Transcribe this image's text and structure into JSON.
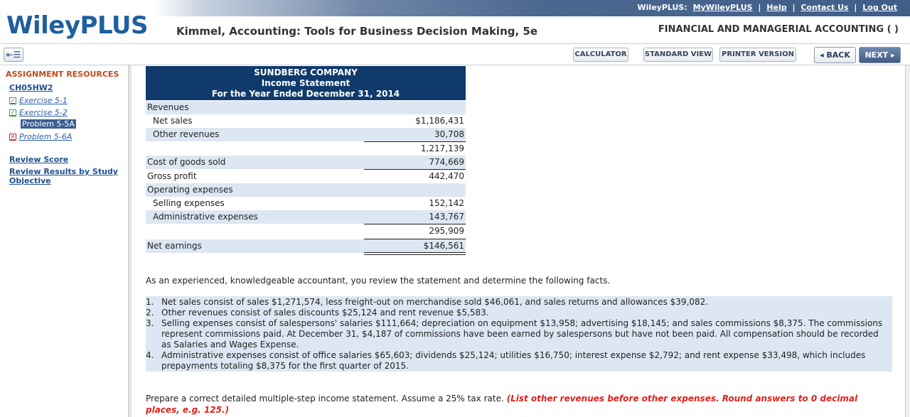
{
  "header": {
    "logo": "WileyPLUS",
    "top_links": {
      "prefix": "WileyPLUS:",
      "my": "MyWileyPLUS",
      "help": "Help",
      "contact": "Contact Us",
      "logout": "Log Out",
      "sep": "|"
    },
    "course_title": "Kimmel, Accounting: Tools for Business Decision Making, 5e",
    "course_name": "FINANCIAL AND MANAGERIAL ACCOUNTING ( )"
  },
  "toolbar": {
    "toggle_icon": "panel-toggle-icon",
    "calculator": "CALCULATOR",
    "standard_view": "STANDARD VIEW",
    "printer_version": "PRINTER VERSION",
    "back": "◂ BACK",
    "next": "NEXT ▸"
  },
  "sidebar": {
    "title": "ASSIGNMENT RESOURCES",
    "assignment": "CH05HW2",
    "items": [
      {
        "label": "Exercise 5-1",
        "status": "complete"
      },
      {
        "label": "Exercise 5-2",
        "status": "complete"
      },
      {
        "label": "Problem 5-5A",
        "status": "current"
      },
      {
        "label": "Problem 5-6A",
        "status": "incorrect"
      }
    ],
    "review_score": "Review Score",
    "review_results": "Review Results by Study Objective"
  },
  "statement": {
    "company": "SUNDBERG COMPANY",
    "title": "Income Statement",
    "period": "For the Year Ended December 31, 2014",
    "rows": [
      {
        "label": "Revenues",
        "amount": ""
      },
      {
        "label": "Net sales",
        "amount": "$1,186,431"
      },
      {
        "label": "Other revenues",
        "amount": "30,708"
      },
      {
        "label": "",
        "amount": "1,217,139"
      },
      {
        "label": "Cost of goods sold",
        "amount": "774,669"
      },
      {
        "label": "Gross profit",
        "amount": "442,470"
      },
      {
        "label": "Operating expenses",
        "amount": ""
      },
      {
        "label": "Selling expenses",
        "amount": "152,142"
      },
      {
        "label": "Administrative expenses",
        "amount": "143,767"
      },
      {
        "label": "",
        "amount": "295,909"
      },
      {
        "label": "Net earnings",
        "amount": "$146,561"
      }
    ]
  },
  "intro": "As an experienced, knowledgeable accountant, you review the statement and determine the following facts.",
  "facts": [
    {
      "num": "1.",
      "text": "Net sales consist of sales $1,271,574, less freight-out on merchandise sold $46,061, and sales returns and allowances $39,082."
    },
    {
      "num": "2.",
      "text": "Other revenues consist of sales discounts $25,124 and rent revenue $5,583."
    },
    {
      "num": "3.",
      "text": "Selling expenses consist of salespersons' salaries $111,664; depreciation on equipment $13,958; advertising $18,145; and sales commissions $8,375. The commissions represent commissions paid. At December 31, $4,187 of commissions have been earned by salespersons but have not been paid. All compensation should be recorded as Salaries and Wages Expense."
    },
    {
      "num": "4.",
      "text": "Administrative expenses consist of office salaries $65,603; dividends $25,124; utilities $16,750; interest expense $2,792; and rent expense $33,498, which includes prepayments totaling $8,375 for the first quarter of 2015."
    }
  ],
  "prepare": {
    "text": "Prepare a correct detailed multiple-step income statement. Assume a 25% tax rate.",
    "instruction": "(List other revenues before other expenses. Round answers to 0 decimal places, e.g. 125.)"
  },
  "colors": {
    "brand": "#1f5f9f",
    "statement_header": "#0f3a6b",
    "row_shade": "#dde7f3",
    "instruction_red": "#e0201a"
  }
}
